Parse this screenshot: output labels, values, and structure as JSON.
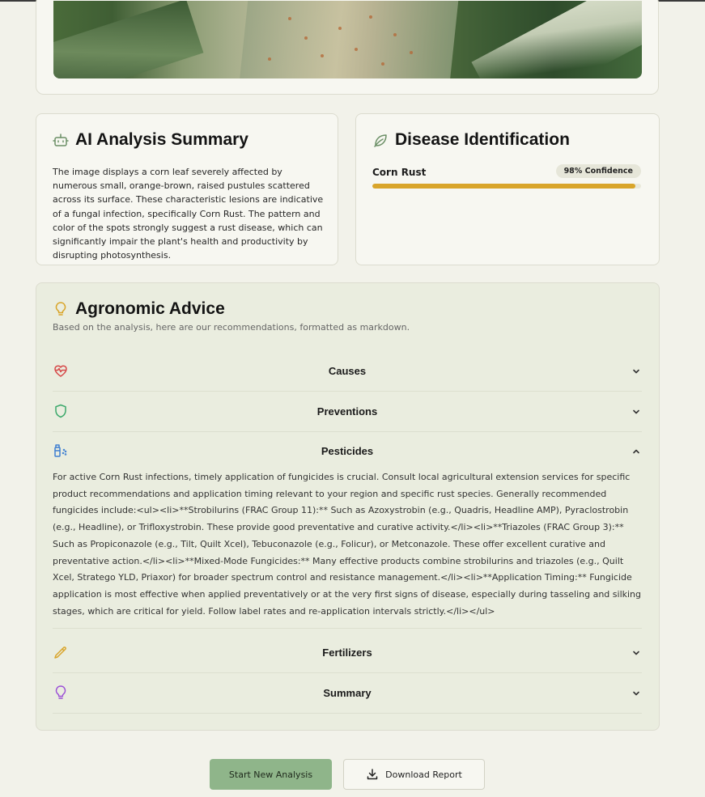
{
  "summary_card": {
    "title": "AI Analysis Summary",
    "text": "The image displays a corn leaf severely affected by numerous small, orange-brown, raised pustules scattered across its surface. These characteristic lesions are indicative of a fungal infection, specifically Corn Rust. The pattern and color of the spots strongly suggest a rust disease, which can significantly impair the plant's health and productivity by disrupting photosynthesis."
  },
  "disease_card": {
    "title": "Disease Identification",
    "disease": "Corn Rust",
    "confidence_label": "98% Confidence",
    "confidence": 0.98
  },
  "advice": {
    "title": "Agronomic Advice",
    "subtitle": "Based on the analysis, here are our recommendations, formatted as markdown.",
    "sections": [
      {
        "label": "Causes",
        "icon": "heart-pulse-icon",
        "expanded": false
      },
      {
        "label": "Preventions",
        "icon": "shield-icon",
        "expanded": false
      },
      {
        "label": "Pesticides",
        "icon": "spray-bottle-icon",
        "expanded": true,
        "body": "For active Corn Rust infections, timely application of fungicides is crucial. Consult local agricultural extension services for specific product recommendations and application timing relevant to your region and specific rust species. Generally recommended fungicides include:<ul><li>**Strobilurins (FRAC Group 11):** Such as Azoxystrobin (e.g., Quadris, Headline AMP), Pyraclostrobin (e.g., Headline), or Trifloxystrobin. These provide good preventative and curative activity.</li><li>**Triazoles (FRAC Group 3):** Such as Propiconazole (e.g., Tilt, Quilt Xcel), Tebuconazole (e.g., Folicur), or Metconazole. These offer excellent curative and preventative action.</li><li>**Mixed-Mode Fungicides:** Many effective products combine strobilurins and triazoles (e.g., Quilt Xcel, Stratego YLD, Priaxor) for broader spectrum control and resistance management.</li><li>**Application Timing:** Fungicide application is most effective when applied preventatively or at the very first signs of disease, especially during tasseling and silking stages, which are critical for yield. Follow label rates and re-application intervals strictly.</li></ul>"
      },
      {
        "label": "Fertilizers",
        "icon": "pipette-icon",
        "expanded": false
      },
      {
        "label": "Summary",
        "icon": "lightbulb-icon",
        "expanded": false
      }
    ]
  },
  "buttons": {
    "start_new": "Start New Analysis",
    "download": "Download Report"
  },
  "colors": {
    "accent_green": "#8fb58a",
    "progress": "#d9a52a",
    "background": "#f2f2ea"
  }
}
